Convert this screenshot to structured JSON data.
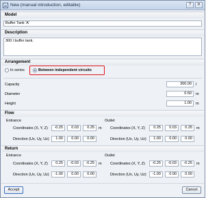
{
  "window": {
    "title": "New (manual introduction, editable)"
  },
  "titlebar": {
    "help_label": "?",
    "close_label": "✕"
  },
  "model": {
    "heading": "Model",
    "value": "Buffer Tank 'A'"
  },
  "description": {
    "heading": "Description",
    "value": "300 l buffer tank."
  },
  "arrangement": {
    "heading": "Arrangement",
    "options": [
      {
        "label": "In series",
        "selected": false
      },
      {
        "label": "Between independent circuits",
        "selected": true
      }
    ]
  },
  "properties": [
    {
      "label": "Capacity",
      "value": "300.00",
      "unit": "l"
    },
    {
      "label": "Diameter",
      "value": "0.50",
      "unit": "m"
    },
    {
      "label": "Height",
      "value": "1.00",
      "unit": "m"
    }
  ],
  "flow": {
    "heading": "Flow",
    "entrance": {
      "heading": "Entrance",
      "coords_label": "Coordinates (X, Y, Z)",
      "coords": [
        "-0.25",
        "0.03",
        "0.25"
      ],
      "coords_unit": "m",
      "dir_label": "Direction (Ux, Uy, Uz)",
      "dir": [
        "1.00",
        "0.00",
        "0.00"
      ]
    },
    "outlet": {
      "heading": "Outlet",
      "coords_label": "Coordinates (X, Y, Z)",
      "coords": [
        "0.25",
        "0.03",
        "0.25"
      ],
      "coords_unit": "m",
      "dir_label": "Direction (Ux, Uy, Uz)",
      "dir": [
        "1.00",
        "0.00",
        "0.00"
      ]
    }
  },
  "return": {
    "heading": "Return",
    "entrance": {
      "heading": "Entrance",
      "coords_label": "Coordinates (X, Y, Z)",
      "coords": [
        "0.25",
        "-0.03",
        "-0.25"
      ],
      "coords_unit": "m",
      "dir_label": "Direction (Ux, Uy, Uz)",
      "dir": [
        "-1.00",
        "0.00",
        "0.00"
      ]
    },
    "outlet": {
      "heading": "Outlet",
      "coords_label": "Coordinates (X, Y, Z)",
      "coords": [
        "-0.25",
        "-0.03",
        "-0.25"
      ],
      "coords_unit": "m",
      "dir_label": "Direction (Ux, Uy, Uz)",
      "dir": [
        "-1.00",
        "0.00",
        "0.00"
      ]
    }
  },
  "buttons": {
    "accept": "Accept",
    "cancel": "Cancel"
  },
  "colors": {
    "highlight": "#e0151b",
    "accent": "#2a4f8a"
  }
}
